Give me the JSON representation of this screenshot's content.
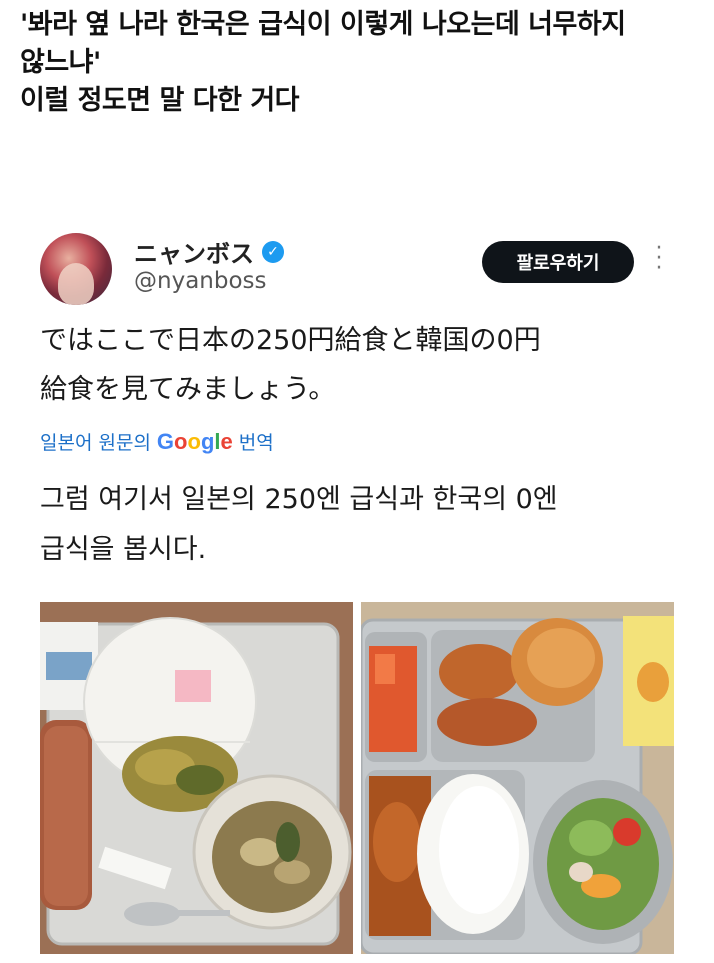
{
  "post": {
    "title": "'봐라 옆 나라 한국은 급식이 이렇게 나오는데 너무하지\n않느냐'\n이럴 정도면 말 다한 거다"
  },
  "tweet": {
    "display_name": "ニャンボス",
    "verified_icon": "verified-badge-icon",
    "handle": "@nyanboss",
    "follow_label": "팔로우하기",
    "more_icon": "more-vertical-icon",
    "text": "ではここで日本の250円給食と韓国の0円\n給食を見てみましょう。",
    "translate_prefix": "일본어 원문의",
    "translate_brand": "Google",
    "translate_suffix": "번역",
    "translated_text": "그럼 여기서 일본의 250엔 급식과 한국의 0엔\n급식을 봅시다.",
    "accent_color": "#1d9bf0"
  },
  "images": {
    "japan_photo": "japanese-school-lunch-photo",
    "korea_photo": "korean-school-lunch-photo"
  }
}
